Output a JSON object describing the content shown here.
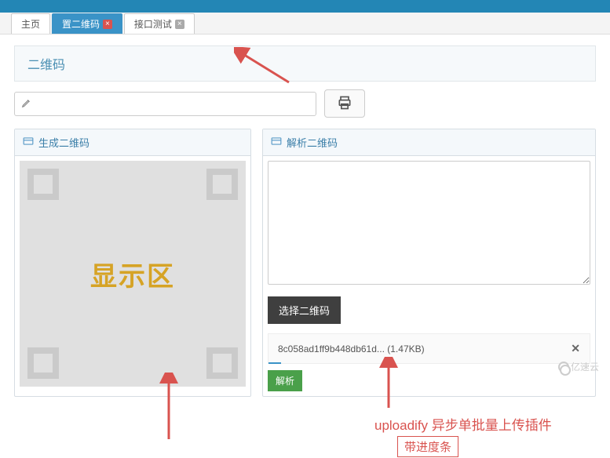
{
  "tabs": [
    {
      "label": "主页",
      "closable": false,
      "active": false
    },
    {
      "label": "置二维码",
      "closable": true,
      "active": true
    },
    {
      "label": "接口测试",
      "closable": true,
      "active": false
    }
  ],
  "page": {
    "title": "二维码"
  },
  "toolbar": {
    "input_value": "",
    "input_placeholder": "",
    "pencil_icon": "pencil-icon",
    "print_icon": "printer-icon"
  },
  "left_panel": {
    "title": "生成二维码",
    "display_label": "显示区"
  },
  "right_panel": {
    "title": "解析二维码",
    "textarea_value": "",
    "select_button": "选择二维码",
    "file": {
      "name": "8c058ad1ff9b448db61d...",
      "size": "(1.47KB)",
      "remove": "✕"
    },
    "parse_button": "解析"
  },
  "annotations": {
    "line1": "uploadify 异步单批量上传插件",
    "line2": "带进度条"
  },
  "watermark": "亿速云"
}
